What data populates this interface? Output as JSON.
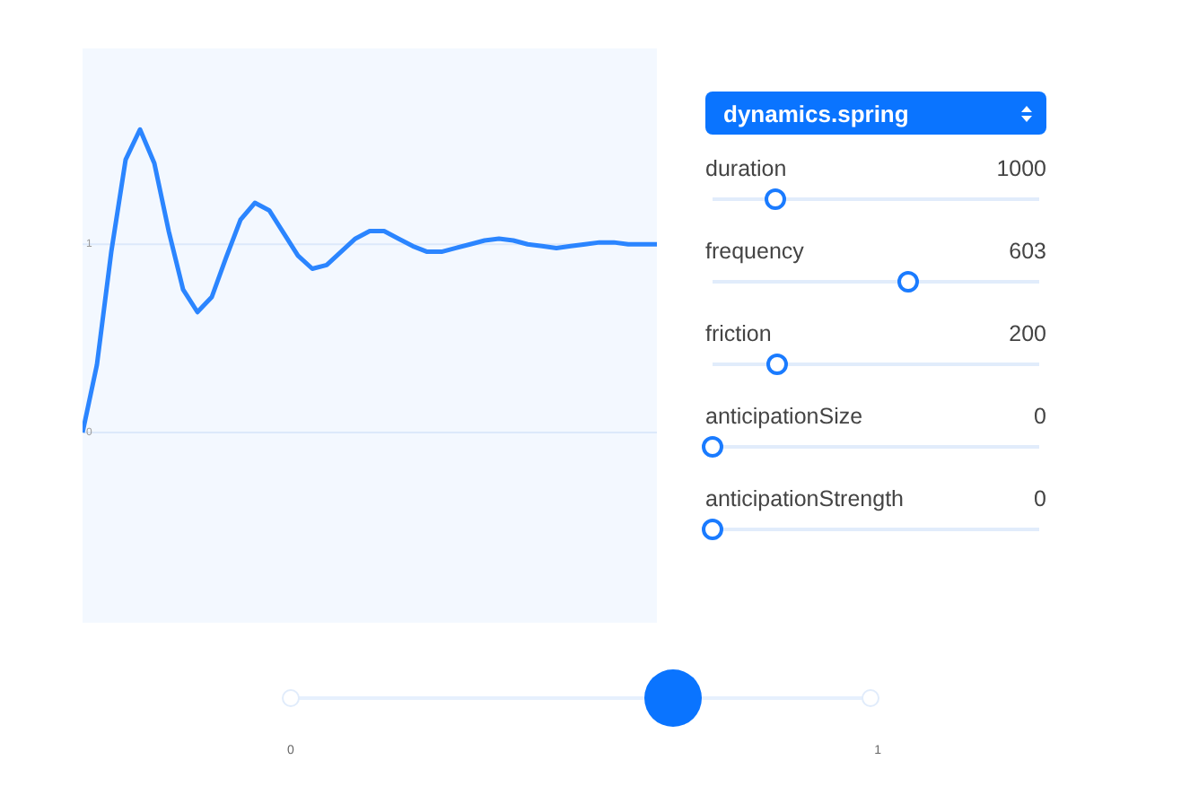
{
  "chart": {
    "chart_data": {
      "type": "line",
      "categories": [
        null,
        null,
        null,
        null,
        null,
        null,
        null,
        null,
        null,
        null,
        null,
        null,
        null,
        null,
        null,
        null,
        null,
        null,
        null,
        null,
        null,
        null,
        null,
        null,
        null,
        null,
        null,
        null,
        null,
        null,
        null,
        null,
        null,
        null,
        null,
        null,
        null,
        null,
        null,
        null,
        null
      ],
      "ylim": [
        -1.01,
        2.04
      ],
      "yticks": [
        0,
        1
      ],
      "series": [
        {
          "color": "#2b85ff",
          "values": [
            0,
            0.36,
            0.96,
            1.45,
            1.61,
            1.43,
            1.07,
            0.76,
            0.64,
            0.72,
            0.93,
            1.13,
            1.22,
            1.18,
            1.06,
            0.94,
            0.87,
            0.89,
            0.96,
            1.03,
            1.07,
            1.07,
            1.03,
            0.99,
            0.96,
            0.96,
            0.98,
            1.0,
            1.02,
            1.03,
            1.02,
            1.0,
            0.99,
            0.98,
            0.99,
            1.0,
            1.01,
            1.01,
            1.0,
            1.0,
            1.0
          ]
        }
      ]
    }
  },
  "dynamic_select": {
    "value": "dynamics.spring"
  },
  "parameters": [
    {
      "name": "duration",
      "reading": "1000",
      "level": 0.19
    },
    {
      "name": "frequency",
      "reading": "603",
      "level": 0.6
    },
    {
      "name": "friction",
      "reading": "200",
      "level": 0.2
    },
    {
      "name": "anticipationSize",
      "reading": "0",
      "level": 0
    },
    {
      "name": "anticipationStrength",
      "reading": "0",
      "level": 0
    }
  ],
  "progress_slider": {
    "level": 0.66,
    "start_label": "0",
    "end_label": "1"
  }
}
